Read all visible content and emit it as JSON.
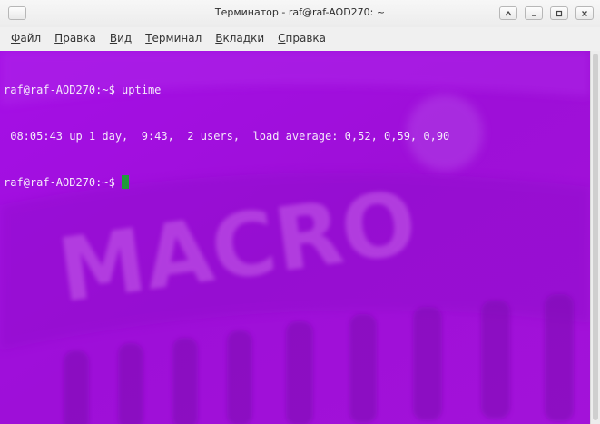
{
  "window": {
    "title": "Терминатор - raf@raf-AOD270: ~"
  },
  "menubar": {
    "items": [
      {
        "accel": "Ф",
        "rest": "айл"
      },
      {
        "accel": "П",
        "rest": "равка"
      },
      {
        "accel": "В",
        "rest": "ид"
      },
      {
        "accel": "Т",
        "rest": "ерминал"
      },
      {
        "accel": "В",
        "rest": "кладки"
      },
      {
        "accel": "С",
        "rest": "правка"
      }
    ]
  },
  "terminal": {
    "lines": [
      "raf@raf-AOD270:~$ uptime",
      " 08:05:43 up 1 day,  9:43,  2 users,  load average: 0,52, 0,59, 0,90"
    ],
    "prompt": "raf@raf-AOD270:~$ ",
    "background_text": "MACRO",
    "colors": {
      "background": "#a310e0",
      "text": "#f4e9fb",
      "cursor": "#1f9b3a"
    }
  }
}
